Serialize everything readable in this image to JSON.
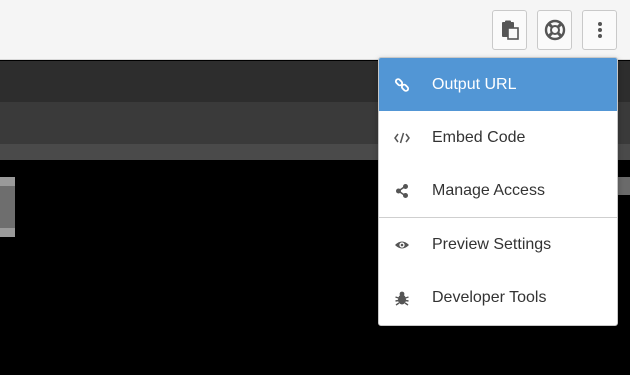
{
  "toolbar": {
    "buttons": [
      {
        "icon": "clipboard-icon"
      },
      {
        "icon": "lifebuoy-icon"
      },
      {
        "icon": "more-vertical-icon"
      }
    ]
  },
  "dropdown_menu": {
    "items": [
      {
        "label": "Output URL",
        "icon": "link-icon",
        "active": true
      },
      {
        "label": "Embed Code",
        "icon": "code-icon",
        "active": false
      },
      {
        "label": "Manage Access",
        "icon": "share-icon",
        "active": false
      },
      {
        "label": "Preview Settings",
        "icon": "eye-icon",
        "active": false
      },
      {
        "label": "Developer Tools",
        "icon": "bug-icon",
        "active": false
      }
    ]
  },
  "colors": {
    "accent": "#5296d5",
    "menu_text": "#333333",
    "icon": "#555555"
  }
}
